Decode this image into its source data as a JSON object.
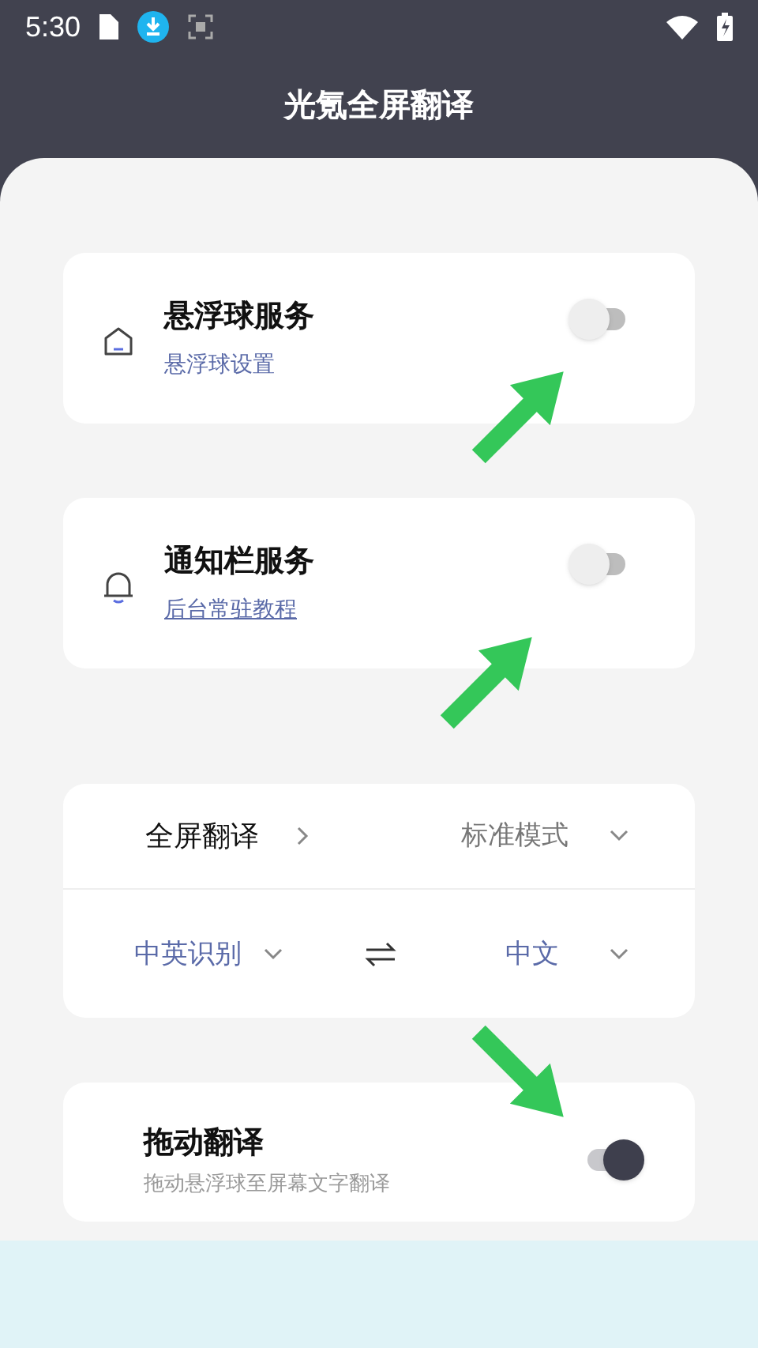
{
  "status_bar": {
    "time": "5:30"
  },
  "header": {
    "title": "光氪全屏翻译"
  },
  "services": [
    {
      "kind": "home",
      "title": "悬浮球服务",
      "link": "悬浮球设置",
      "on": false
    },
    {
      "kind": "bell",
      "title": "通知栏服务",
      "link": "后台常驻教程",
      "on": false
    }
  ],
  "translate": {
    "mode_label": "全屏翻译",
    "mode_value": "标准模式",
    "source": "中英识别",
    "target": "中文"
  },
  "drag": {
    "title": "拖动翻译",
    "subtitle": "拖动悬浮球至屏幕文字翻译",
    "on": true
  },
  "annotations": [
    {
      "kind": "upward"
    },
    {
      "kind": "upward"
    },
    {
      "kind": "downward"
    }
  ]
}
